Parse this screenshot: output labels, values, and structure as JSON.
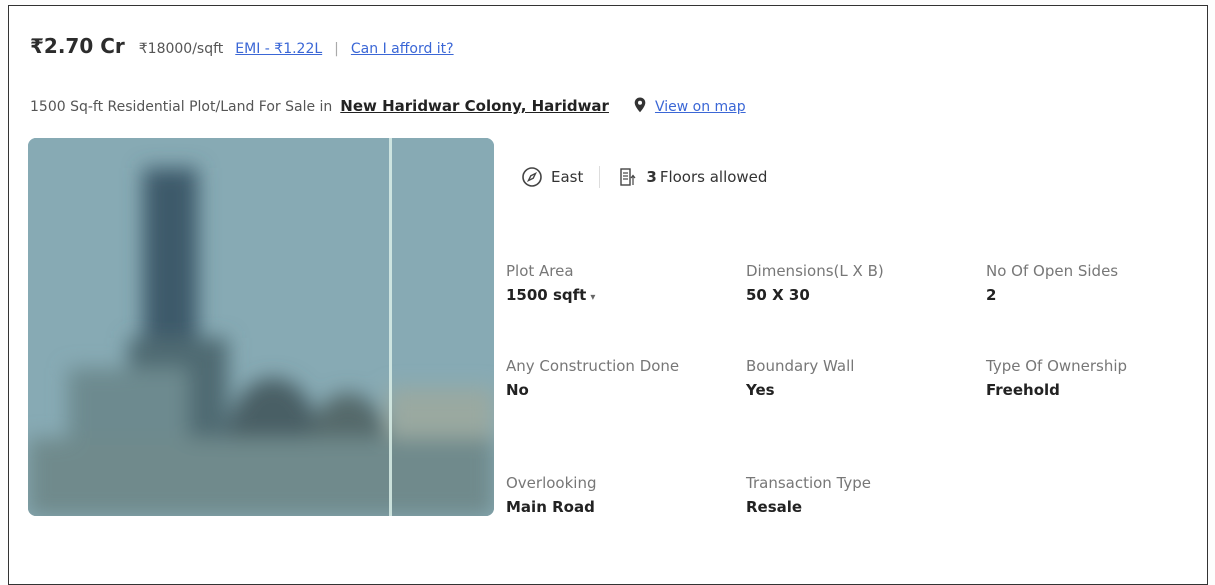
{
  "header": {
    "price": "₹2.70 Cr",
    "price_per_sqft": "₹18000/sqft",
    "emi_link": "EMI - ₹1.22L",
    "separator": "|",
    "afford_link": "Can I afford it?"
  },
  "title": {
    "prefix": "1500 Sq-ft Residential Plot/Land For Sale in",
    "locality": "New Haridwar Colony, Haridwar",
    "map_link": "View on map"
  },
  "facts": {
    "facing": "East",
    "floors_count": "3",
    "floors_label": "Floors allowed"
  },
  "attributes": {
    "plot_area": {
      "label": "Plot Area",
      "value": "1500 sqft"
    },
    "dimensions": {
      "label": "Dimensions(L X B)",
      "value": "50 X 30"
    },
    "open_sides": {
      "label": "No Of Open Sides",
      "value": "2"
    },
    "construction": {
      "label": "Any Construction Done",
      "value": "No"
    },
    "boundary_wall": {
      "label": "Boundary Wall",
      "value": "Yes"
    },
    "ownership": {
      "label": "Type Of Ownership",
      "value": "Freehold"
    },
    "overlooking": {
      "label": "Overlooking",
      "value": "Main Road"
    },
    "transaction": {
      "label": "Transaction Type",
      "value": "Resale"
    }
  },
  "colors": {
    "link": "#3b67d6",
    "text": "#222222",
    "label": "#777777"
  }
}
